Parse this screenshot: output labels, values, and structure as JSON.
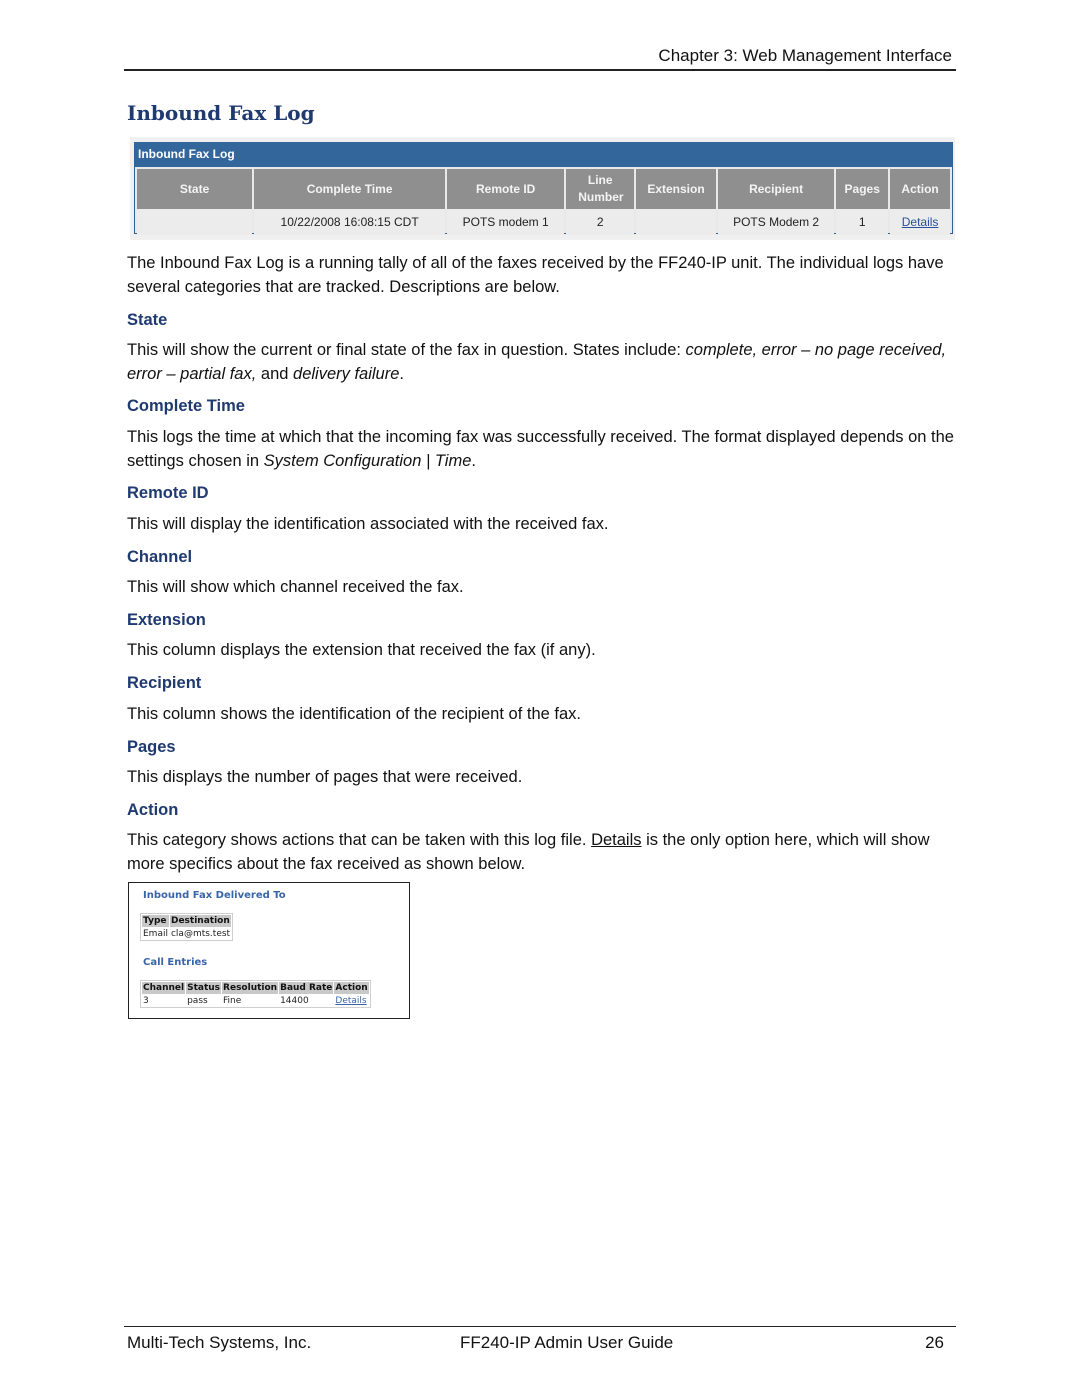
{
  "header": {
    "chapter": "Chapter 3: Web Management Interface"
  },
  "section_title": "Inbound Fax Log",
  "log_screenshot": {
    "panel_title": "Inbound Fax Log",
    "columns": [
      "State",
      "Complete Time",
      "Remote ID",
      "Line Number",
      "Extension",
      "Recipient",
      "Pages",
      "Action"
    ],
    "rows": [
      {
        "state": "",
        "complete_time": "10/22/2008 16:08:15 CDT",
        "remote_id": "POTS modem 1",
        "line_number": "2",
        "extension": "",
        "recipient": "POTS Modem 2",
        "pages": "1",
        "action": "Details"
      }
    ],
    "colors": {
      "title_bar": "#33669a",
      "header_cell": "#8f8f8f",
      "link": "#2b4d9a"
    }
  },
  "intro": "The Inbound Fax Log is a running tally of all of the faxes received by the FF240-IP unit. The individual logs have several categories that are tracked. Descriptions are below.",
  "fields": [
    {
      "heading": "State",
      "text_parts": [
        "This will show the current or final state of the fax in question. States include: ",
        "complete, error – no page received, error – partial fax,",
        " and ",
        "delivery failure",
        "."
      ]
    },
    {
      "heading": "Complete Time",
      "text_parts": [
        "This logs the time at which that the incoming fax was successfully received. The format displayed depends on the settings chosen in ",
        "System Configuration | Time",
        "."
      ]
    },
    {
      "heading": "Remote ID",
      "text": "This will display the identification associated with the received fax."
    },
    {
      "heading": "Channel",
      "text": "This will show which channel received the fax."
    },
    {
      "heading": "Extension",
      "text": "This column displays the extension that received the fax (if any)."
    },
    {
      "heading": "Recipient",
      "text": "This column shows the identification of the recipient of the fax."
    },
    {
      "heading": "Pages",
      "text": "This displays the number of pages that were received."
    },
    {
      "heading": "Action",
      "text_parts": [
        "This category shows actions that can be taken with this log file. ",
        "Details",
        " is the only option here, which will show more specifics about the fax received as shown below."
      ]
    }
  ],
  "details_screenshot": {
    "delivered_title": "Inbound Fax Delivered To",
    "delivered_columns": [
      "Type",
      "Destination"
    ],
    "delivered_rows": [
      {
        "type": "Email",
        "destination": "cla@mts.test"
      }
    ],
    "call_entries_title": "Call Entries",
    "call_columns": [
      "Channel",
      "Status",
      "Resolution",
      "Baud Rate",
      "Action"
    ],
    "call_rows": [
      {
        "channel": "3",
        "status": "pass",
        "resolution": "Fine",
        "baud_rate": "14400",
        "action": "Details"
      }
    ]
  },
  "footer": {
    "company": "Multi-Tech Systems, Inc.",
    "guide": "FF240-IP Admin User Guide",
    "page_number": "26"
  },
  "colors": {
    "heading": "#1f3a70",
    "subheading": "#1f3a70"
  }
}
